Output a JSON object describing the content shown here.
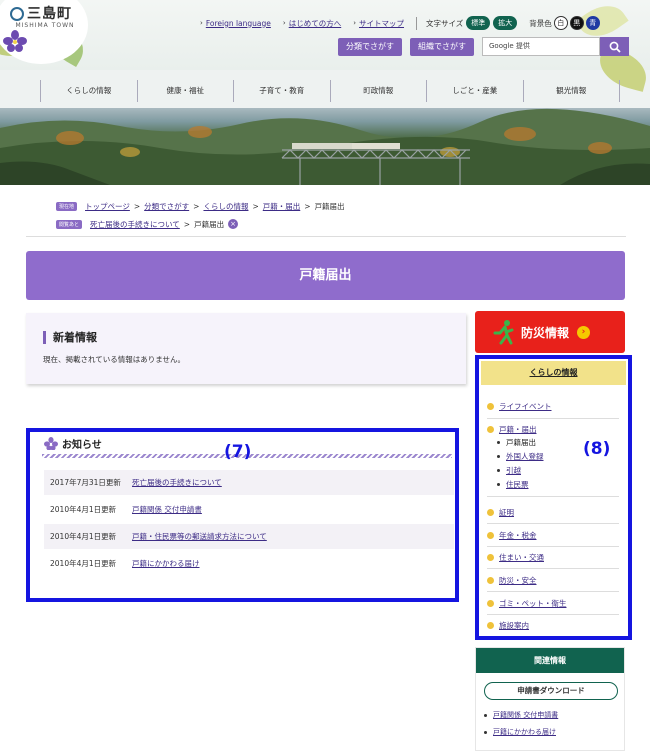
{
  "header": {
    "logo_jp": "三島町",
    "logo_en": "MISHIMA TOWN",
    "utility_links": [
      "Foreign language",
      "はじめての方へ",
      "サイトマップ"
    ],
    "font_size_label": "文字サイズ",
    "font_size_normal": "標準",
    "font_size_large": "拡大",
    "bg_color_label": "背景色",
    "bg_white": "白",
    "bg_black": "黒",
    "bg_blue": "青",
    "search_by_category": "分類でさがす",
    "search_by_org": "組織でさがす",
    "search_placeholder": "Google 提供"
  },
  "global_nav": [
    "くらしの情報",
    "健康・福祉",
    "子育て・教育",
    "町政情報",
    "しごと・産業",
    "観光情報"
  ],
  "breadcrumb": {
    "tag1": "現在地",
    "row1_links": [
      "トップページ",
      "分類でさがす",
      "くらしの情報",
      "戸籍・届出"
    ],
    "row1_current": "戸籍届出",
    "tag2": "閲覧あと",
    "row2_link": "死亡届後の手続きについて",
    "row2_current": "戸籍届出",
    "remove_glyph": "×"
  },
  "page_title": "戸籍届出",
  "new_info": {
    "title": "新着情報",
    "text": "現在、掲載されている情報はありません。"
  },
  "notices": {
    "title": "お知らせ",
    "annotation": "(7)",
    "rows": [
      {
        "date": "2017年7月31日更新",
        "link": "死亡届後の手続きについて"
      },
      {
        "date": "2010年4月1日更新",
        "link": "戸籍関係 交付申請書"
      },
      {
        "date": "2010年4月1日更新",
        "link": "戸籍・住民票等の郵送請求方法について"
      },
      {
        "date": "2010年4月1日更新",
        "link": "戸籍にかかわる届け"
      }
    ]
  },
  "bousai": {
    "label": "防災情報",
    "go": "›"
  },
  "side_nav": {
    "title": "くらしの情報",
    "annotation": "(8)",
    "items": [
      {
        "label": "ライフイベント"
      },
      {
        "label": "戸籍・届出"
      },
      {
        "label": "証明"
      },
      {
        "label": "年金・税金"
      },
      {
        "label": "住まい・交通"
      },
      {
        "label": "防災・安全"
      },
      {
        "label": "ゴミ・ペット・衛生"
      },
      {
        "label": "施設案内"
      }
    ],
    "sub_items": [
      {
        "label": "戸籍届出"
      },
      {
        "label": "外国人登録"
      },
      {
        "label": "引越"
      },
      {
        "label": "住民票"
      }
    ]
  },
  "related": {
    "title": "関連情報",
    "button": "申請書ダウンロード",
    "links": [
      "戸籍関係 交付申請書",
      "戸籍にかかわる届け"
    ]
  },
  "colors": {
    "purple": "#8f6ccc",
    "green": "#11634f",
    "red": "#e8211b",
    "annotation_blue": "#1515e0"
  }
}
